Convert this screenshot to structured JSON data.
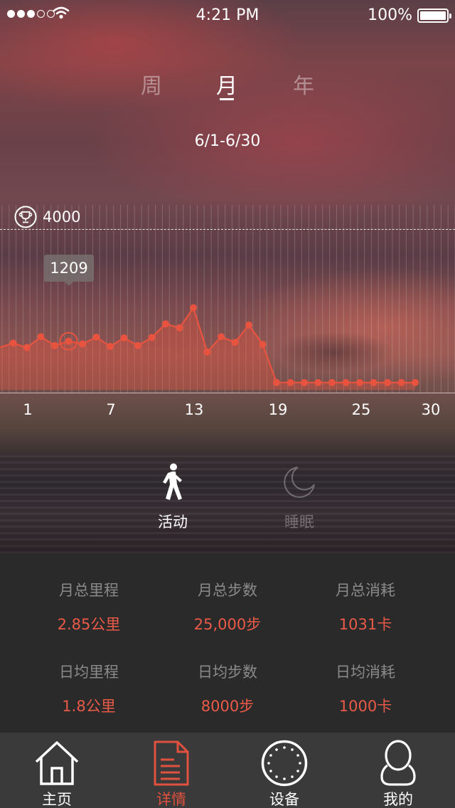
{
  "status_bar": {
    "time": "4:21 PM",
    "battery": "100%"
  },
  "period_tabs": [
    {
      "label": "周",
      "active": false
    },
    {
      "label": "月",
      "active": true
    },
    {
      "label": "年",
      "active": false
    }
  ],
  "date_range": "6/1-6/30",
  "goal": {
    "value": "4000",
    "icon": "trophy-icon"
  },
  "tooltip": {
    "value": "1209"
  },
  "chart_data": {
    "type": "line",
    "x": [
      1,
      2,
      3,
      4,
      5,
      6,
      7,
      8,
      9,
      10,
      11,
      12,
      13,
      14,
      15,
      16,
      17,
      18,
      19,
      20,
      21,
      22,
      23,
      24,
      25,
      26,
      27,
      28,
      29,
      30
    ],
    "x_ticks": [
      "1",
      "7",
      "13",
      "19",
      "25",
      "30"
    ],
    "series": [
      {
        "values": [
          1160,
          1050,
          1320,
          1100,
          1209,
          1140,
          1310,
          1080,
          1290,
          1100,
          1300,
          1640,
          1540,
          2040,
          940,
          1320,
          1180,
          1610,
          1130,
          180,
          180,
          180,
          180,
          180,
          180,
          180,
          180,
          180,
          180,
          180
        ]
      }
    ],
    "highlight": {
      "x": 5,
      "value": 1209
    },
    "goal": 4000,
    "color": "#e8533f"
  },
  "modes": [
    {
      "label": "活动",
      "icon": "walking-icon",
      "active": true
    },
    {
      "label": "睡眠",
      "icon": "moon-icon",
      "active": false
    }
  ],
  "stats": {
    "monthly_distance": {
      "label": "月总里程",
      "value": "2.85公里"
    },
    "monthly_steps": {
      "label": "月总步数",
      "value": "25,000步"
    },
    "monthly_calories": {
      "label": "月总消耗",
      "value": "1031卡"
    },
    "daily_distance": {
      "label": "日均里程",
      "value": "1.8公里"
    },
    "daily_steps": {
      "label": "日均步数",
      "value": "8000步"
    },
    "daily_calories": {
      "label": "日均消耗",
      "value": "1000卡"
    }
  },
  "tab_bar": [
    {
      "label": "主页",
      "icon": "home-icon",
      "active": false
    },
    {
      "label": "详情",
      "icon": "document-icon",
      "active": true
    },
    {
      "label": "设备",
      "icon": "device-icon",
      "active": false
    },
    {
      "label": "我的",
      "icon": "user-icon",
      "active": false
    }
  ],
  "colors": {
    "accent": "#e8533f",
    "panel": "#2a2a2a",
    "tabbar": "#3a3a3a"
  }
}
